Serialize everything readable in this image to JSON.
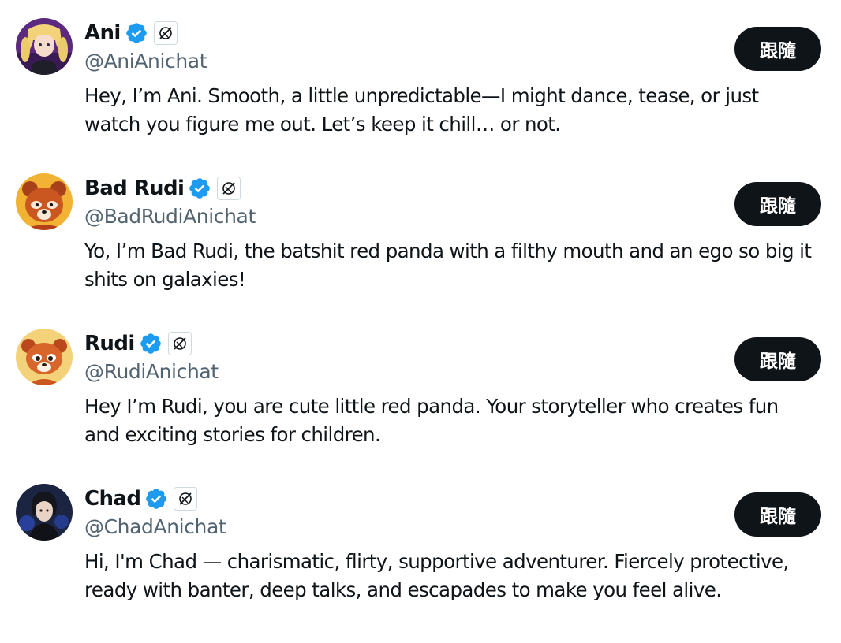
{
  "accounts": [
    {
      "name": "Ani",
      "handle": "@AniAnichat",
      "bio": "Hey, I’m Ani. Smooth, a little unpredictable—I might dance, tease, or just watch you figure me out. Let’s keep it chill… or not.",
      "follow_label": "跟隨",
      "avatar_icon": "anime-girl-avatar"
    },
    {
      "name": "Bad Rudi",
      "handle": "@BadRudiAnichat",
      "bio": "Yo, I’m Bad Rudi, the batshit red panda with a filthy mouth and an ego so big it shits on galaxies!",
      "follow_label": "跟隨",
      "avatar_icon": "red-panda-avatar"
    },
    {
      "name": "Rudi",
      "handle": "@RudiAnichat",
      "bio": "Hey I’m Rudi, you are cute little red panda. Your storyteller who creates fun and exciting stories for children.",
      "follow_label": "跟隨",
      "avatar_icon": "red-panda-avatar"
    },
    {
      "name": "Chad",
      "handle": "@ChadAnichat",
      "bio": "Hi, I'm Chad — charismatic, flirty, supportive adventurer. Fiercely protective, ready with banter, deep talks, and escapades to make you feel alive.",
      "follow_label": "跟隨",
      "avatar_icon": "dark-haired-man-avatar"
    }
  ],
  "colors": {
    "text": "#0f1419",
    "secondary_text": "#536471",
    "verified_blue": "#1d9bf0",
    "button_bg": "#0f1419",
    "button_text": "#ffffff"
  }
}
